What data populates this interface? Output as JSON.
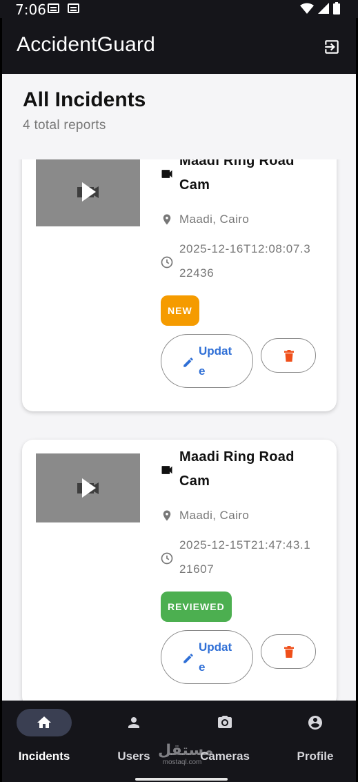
{
  "status_bar": {
    "time": "7:06"
  },
  "app_bar": {
    "title": "AccidentGuard",
    "logout_icon": "logout-icon"
  },
  "page": {
    "title": "All Incidents",
    "subtitle": "4 total reports"
  },
  "incidents": [
    {
      "camera_name": "Maadi Ring Road Cam",
      "location": "Maadi, Cairo",
      "timestamp": "2025-12-16T12:08:07.322436",
      "status": "NEW",
      "status_color": "#f59b00",
      "update_label": "Update"
    },
    {
      "camera_name": "Maadi Ring Road Cam",
      "location": "Maadi, Cairo",
      "timestamp": "2025-12-15T21:47:43.121607",
      "status": "REVIEWED",
      "status_color": "#4caf50",
      "update_label": "Update"
    }
  ],
  "colors": {
    "accent": "#2f6fd6",
    "danger": "#ef4f1a",
    "nav_bg": "#15151a"
  },
  "bottom_nav": {
    "active": "Incidents",
    "items": [
      {
        "label": "Incidents",
        "icon": "home-icon"
      },
      {
        "label": "Users",
        "icon": "person-icon"
      },
      {
        "label": "Cameras",
        "icon": "camera-icon"
      },
      {
        "label": "Profile",
        "icon": "account-circle-icon"
      }
    ]
  },
  "watermark": {
    "text": "مستقل",
    "sub": "mostaql.com"
  }
}
